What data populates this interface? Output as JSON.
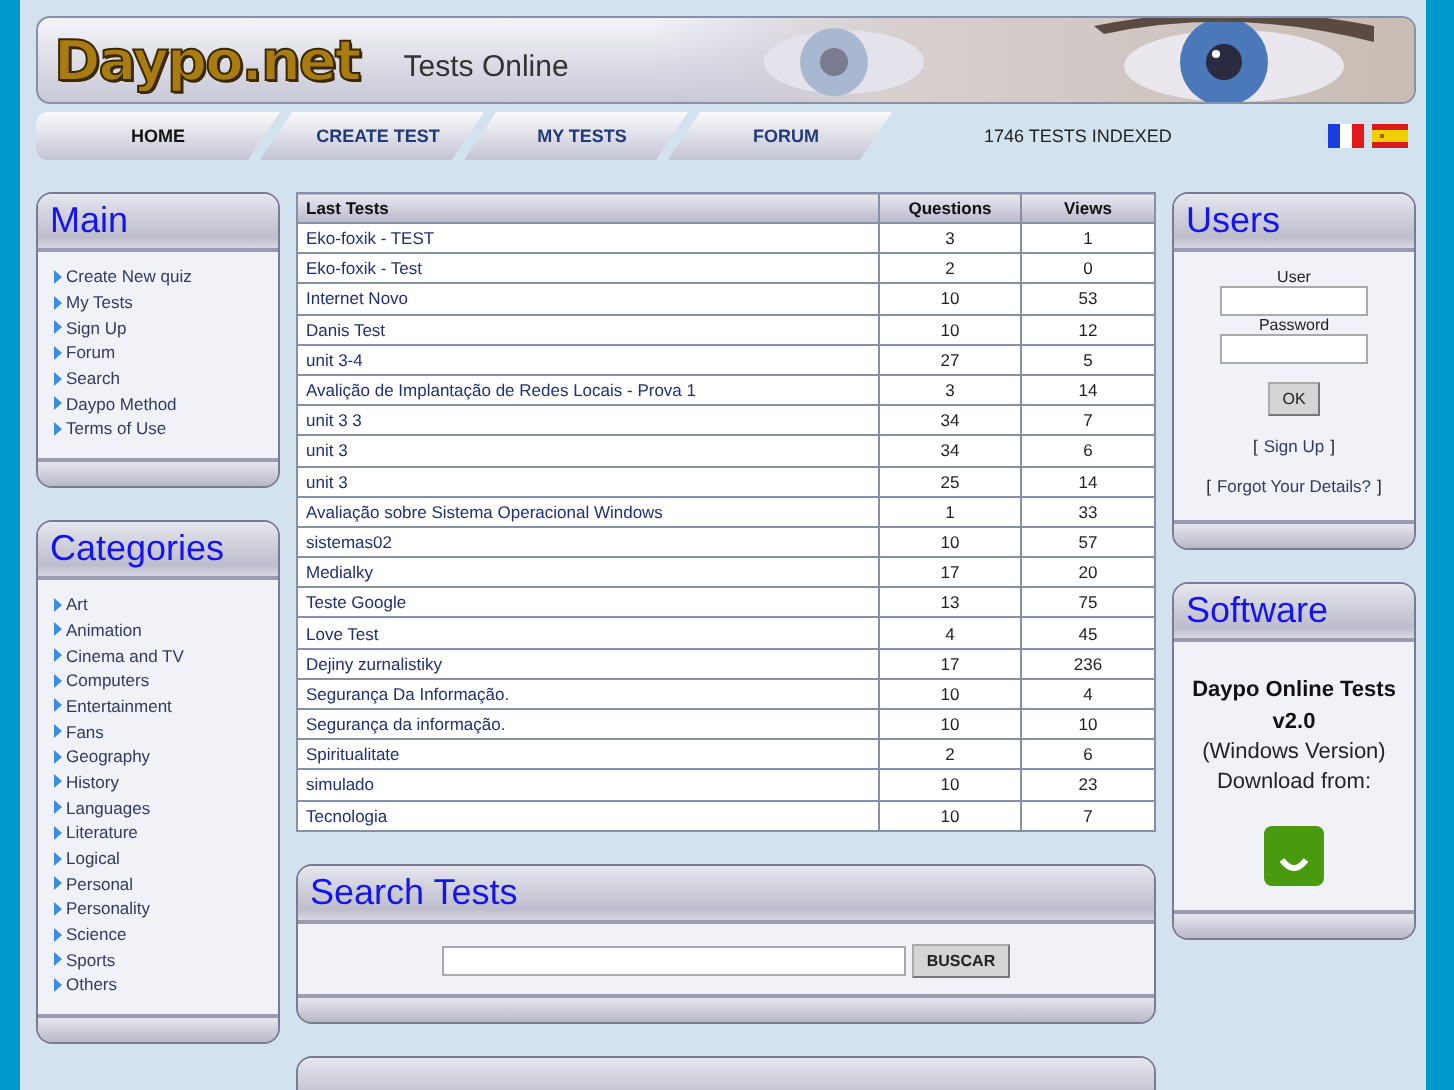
{
  "header": {
    "logo": "Daypo.net",
    "tagline": "Tests Online"
  },
  "nav": {
    "tabs": [
      {
        "label": "HOME",
        "selected": true
      },
      {
        "label": "CREATE TEST",
        "selected": false
      },
      {
        "label": "MY TESTS",
        "selected": false
      },
      {
        "label": "FORUM",
        "selected": false
      }
    ],
    "count": "1746 TESTS INDEXED"
  },
  "main": {
    "title": "Main",
    "links": [
      "Create New quiz",
      "My Tests",
      "Sign Up",
      "Forum",
      "Search",
      "Daypo Method",
      "Terms of Use"
    ]
  },
  "categories": {
    "title": "Categories",
    "links": [
      "Art",
      "Animation",
      "Cinema and TV",
      "Computers",
      "Entertainment",
      "Fans",
      "Geography",
      "History",
      "Languages",
      "Literature",
      "Logical",
      "Personal",
      "Personality",
      "Science",
      "Sports",
      "Others"
    ]
  },
  "last_tests": {
    "columns": [
      "Last Tests",
      "Questions",
      "Views"
    ],
    "rows": [
      [
        "Eko-foxik - TEST",
        "3",
        "1"
      ],
      [
        "Eko-foxik - Test",
        "2",
        "0"
      ],
      [
        "Internet Novo",
        "10",
        "53"
      ],
      [
        "Danis Test",
        "10",
        "12"
      ],
      [
        "unit 3-4",
        "27",
        "5"
      ],
      [
        "Avalição de Implantação de Redes Locais - Prova 1",
        "3",
        "14"
      ],
      [
        "unit 3 3",
        "34",
        "7"
      ],
      [
        "unit 3",
        "34",
        "6"
      ],
      [
        "unit 3",
        "25",
        "14"
      ],
      [
        "Avaliação sobre Sistema Operacional Windows",
        "1",
        "33"
      ],
      [
        "sistemas02",
        "10",
        "57"
      ],
      [
        "Medialky",
        "17",
        "20"
      ],
      [
        "Teste Google",
        "13",
        "75"
      ],
      [
        "Love Test",
        "4",
        "45"
      ],
      [
        "Dejiny zurnalistiky",
        "17",
        "236"
      ],
      [
        "Segurança Da Informação.",
        "10",
        "4"
      ],
      [
        "Segurança da informação.",
        "10",
        "10"
      ],
      [
        "Spiritualitate",
        "2",
        "6"
      ],
      [
        "simulado",
        "10",
        "23"
      ],
      [
        "Tecnologia",
        "10",
        "7"
      ]
    ]
  },
  "search": {
    "title": "Search Tests",
    "button": "BUSCAR"
  },
  "users": {
    "title": "Users",
    "user_label": "User",
    "password_label": "Password",
    "ok": "OK",
    "sign_up": {
      "open": "[",
      "link": "Sign Up",
      "close": "]"
    },
    "forgot": {
      "open": "[",
      "link": "Forgot Your Details?",
      "close": "]"
    }
  },
  "software": {
    "title": "Software",
    "name": "Daypo Online Tests v2.0",
    "version": "(Windows Version)",
    "download": "Download from:"
  }
}
